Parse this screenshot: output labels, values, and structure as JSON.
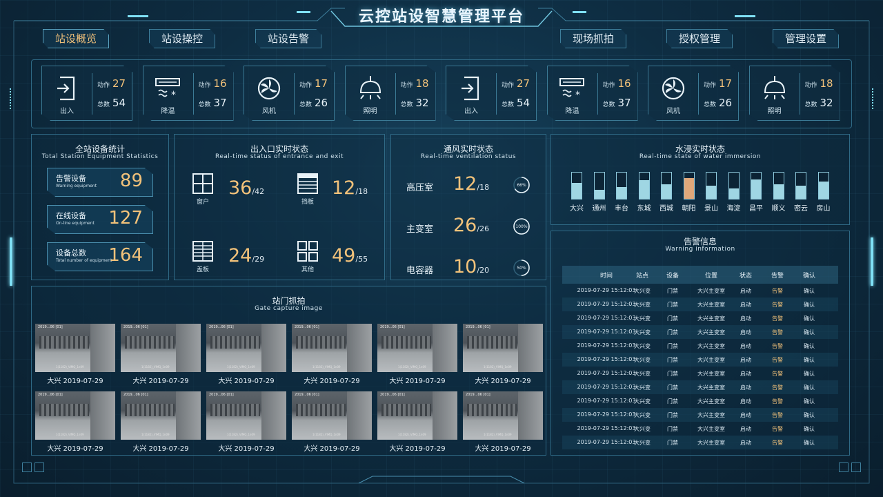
{
  "title": "云控站设智慧管理平台",
  "nav": [
    {
      "label": "站设概览",
      "active": true
    },
    {
      "label": "站设操控",
      "active": false
    },
    {
      "label": "站设告警",
      "active": false
    },
    {
      "label": "现场抓拍",
      "active": false
    },
    {
      "label": "授权管理",
      "active": false
    },
    {
      "label": "管理设置",
      "active": false
    }
  ],
  "topbar": {
    "action_label": "动作",
    "total_label": "总数",
    "cards": [
      {
        "icon": "entrance-icon",
        "label": "出入",
        "action": "27",
        "total": "54"
      },
      {
        "icon": "air-conditioner-icon",
        "label": "降温",
        "action": "16",
        "total": "37"
      },
      {
        "icon": "fan-icon",
        "label": "风机",
        "action": "17",
        "total": "26"
      },
      {
        "icon": "ceiling-lamp-icon",
        "label": "照明",
        "action": "18",
        "total": "32"
      },
      {
        "icon": "entrance-icon",
        "label": "出入",
        "action": "27",
        "total": "54"
      },
      {
        "icon": "air-conditioner-icon",
        "label": "降温",
        "action": "16",
        "total": "37"
      },
      {
        "icon": "fan-icon",
        "label": "风机",
        "action": "17",
        "total": "26"
      },
      {
        "icon": "ceiling-lamp-icon",
        "label": "照明",
        "action": "18",
        "total": "32"
      }
    ]
  },
  "equipment_stats": {
    "title": "全站设备统计",
    "subtitle": "Total Station Equipment Statistics",
    "items": [
      {
        "label": "告警设备",
        "en": "Warning equipment",
        "value": "89"
      },
      {
        "label": "在线设备",
        "en": "On-line equipment",
        "value": "127"
      },
      {
        "label": "设备总数",
        "en": "Total number of equipment",
        "value": "164"
      }
    ]
  },
  "entrance": {
    "title": "出入口实时状态",
    "subtitle": "Real-time status of entrance and exit",
    "items": [
      {
        "icon": "window-icon",
        "label": "窗户",
        "value": "36",
        "total": "/42"
      },
      {
        "icon": "baffle-icon",
        "label": "挡板",
        "value": "12",
        "total": "/18"
      },
      {
        "icon": "cover-plate-icon",
        "label": "盖板",
        "value": "24",
        "total": "/29"
      },
      {
        "icon": "grid-icon",
        "label": "其他",
        "value": "49",
        "total": "/55"
      }
    ]
  },
  "ventilation": {
    "title": "通风实时状态",
    "subtitle": "Real-time ventilation status",
    "items": [
      {
        "label": "高压室",
        "value": "12",
        "total": "/18",
        "percent": 66,
        "percent_label": "66%"
      },
      {
        "label": "主变室",
        "value": "26",
        "total": "/26",
        "percent": 100,
        "percent_label": "100%"
      },
      {
        "label": "电容器",
        "value": "10",
        "total": "/20",
        "percent": 50,
        "percent_label": "50%"
      }
    ]
  },
  "water": {
    "title": "水浸实时状态",
    "subtitle": "Real-time state of water immersion",
    "items": [
      {
        "label": "大兴",
        "level": 0.6,
        "warn": false
      },
      {
        "label": "通州",
        "level": 0.35,
        "warn": false
      },
      {
        "label": "丰台",
        "level": 0.45,
        "warn": false
      },
      {
        "label": "东城",
        "level": 0.7,
        "warn": false
      },
      {
        "label": "西城",
        "level": 0.55,
        "warn": false
      },
      {
        "label": "朝阳",
        "level": 0.8,
        "warn": true
      },
      {
        "label": "景山",
        "level": 0.5,
        "warn": false
      },
      {
        "label": "海淀",
        "level": 0.4,
        "warn": false
      },
      {
        "label": "昌平",
        "level": 0.75,
        "warn": false
      },
      {
        "label": "顺义",
        "level": 0.55,
        "warn": false
      },
      {
        "label": "密云",
        "level": 0.5,
        "warn": false
      },
      {
        "label": "房山",
        "level": 0.65,
        "warn": false
      }
    ]
  },
  "gate": {
    "title": "站门抓拍",
    "subtitle": "Gate capture image",
    "images": [
      {
        "stamp": "2019...06 [01]",
        "camera": "1(1182)_VIMQ_1n09",
        "caption": "大兴  2019-07-29"
      },
      {
        "stamp": "2019...06 [01]",
        "camera": "1(1182)_VIMQ_1n09",
        "caption": "大兴  2019-07-29"
      },
      {
        "stamp": "2019...06 [01]",
        "camera": "1(1182)_VIMQ_1n09",
        "caption": "大兴  2019-07-29"
      },
      {
        "stamp": "2019...06 [01]",
        "camera": "1(1182)_VIMQ_1n09",
        "caption": "大兴  2019-07-29"
      },
      {
        "stamp": "2019...06 [01]",
        "camera": "1(1182)_VIMQ_1n09",
        "caption": "大兴  2019-07-29"
      },
      {
        "stamp": "2019...06 [01]",
        "camera": "1(1182)_VIMQ_1n09",
        "caption": "大兴  2019-07-29"
      },
      {
        "stamp": "2019...06 [01]",
        "camera": "1(1182)_VIMQ_1n09",
        "caption": "大兴  2019-07-29"
      },
      {
        "stamp": "2019...06 [01]",
        "camera": "1(1182)_VIMQ_1n09",
        "caption": "大兴  2019-07-29"
      },
      {
        "stamp": "2019...06 [01]",
        "camera": "1(1182)_VIMQ_1n09",
        "caption": "大兴  2019-07-29"
      },
      {
        "stamp": "2019...06 [01]",
        "camera": "1(1182)_VIMQ_1n09",
        "caption": "大兴  2019-07-29"
      },
      {
        "stamp": "2019...06 [01]",
        "camera": "1(1182)_VIMQ_1n09",
        "caption": "大兴  2019-07-29"
      },
      {
        "stamp": "2019...06 [01]",
        "camera": "1(1182)_VIMQ_1n09",
        "caption": "大兴  2019-07-29"
      }
    ]
  },
  "warnings": {
    "title": "告警信息",
    "subtitle": "Warning information",
    "columns": [
      "时间",
      "站点",
      "设备",
      "位置",
      "状态",
      "告警",
      "确认"
    ],
    "rows": [
      [
        "2019-07-29 15:12:03",
        "大兴变",
        "门禁",
        "大兴主变室",
        "启动",
        "告警",
        "确认"
      ],
      [
        "2019-07-29 15:12:03",
        "大兴变",
        "门禁",
        "大兴主变室",
        "启动",
        "告警",
        "确认"
      ],
      [
        "2019-07-29 15:12:03",
        "大兴变",
        "门禁",
        "大兴主变室",
        "启动",
        "告警",
        "确认"
      ],
      [
        "2019-07-29 15:12:03",
        "大兴变",
        "门禁",
        "大兴主变室",
        "启动",
        "告警",
        "确认"
      ],
      [
        "2019-07-29 15:12:03",
        "大兴变",
        "门禁",
        "大兴主变室",
        "启动",
        "告警",
        "确认"
      ],
      [
        "2019-07-29 15:12:03",
        "大兴变",
        "门禁",
        "大兴主变室",
        "启动",
        "告警",
        "确认"
      ],
      [
        "2019-07-29 15:12:03",
        "大兴变",
        "门禁",
        "大兴主变室",
        "启动",
        "告警",
        "确认"
      ],
      [
        "2019-07-29 15:12:03",
        "大兴变",
        "门禁",
        "大兴主变室",
        "启动",
        "告警",
        "确认"
      ],
      [
        "2019-07-29 15:12:03",
        "大兴变",
        "门禁",
        "大兴主变室",
        "启动",
        "告警",
        "确认"
      ],
      [
        "2019-07-29 15:12:03",
        "大兴变",
        "门禁",
        "大兴主变室",
        "启动",
        "告警",
        "确认"
      ],
      [
        "2019-07-29 15:12:03",
        "大兴变",
        "门禁",
        "大兴主变室",
        "启动",
        "告警",
        "确认"
      ],
      [
        "2019-07-29 15:12:03",
        "大兴变",
        "门禁",
        "大兴主变室",
        "启动",
        "告警",
        "确认"
      ]
    ]
  },
  "colors": {
    "accent": "#7fe0f5",
    "gold": "#f2c27a",
    "warn_fill": "#e0a87a",
    "water_fill": "#9fd6e3"
  }
}
